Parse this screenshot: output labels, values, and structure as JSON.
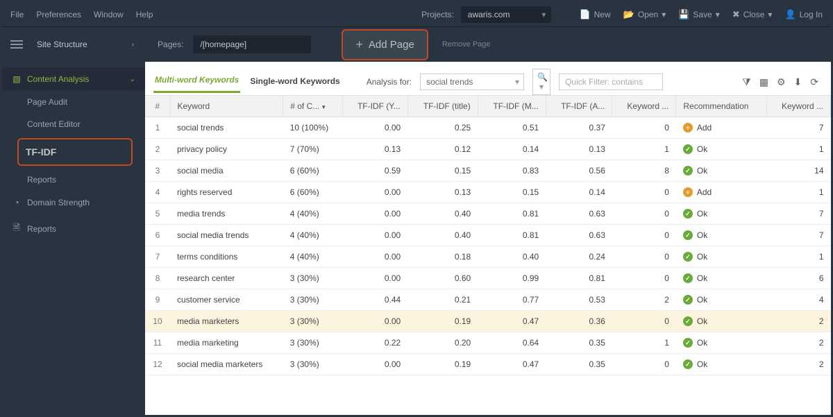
{
  "topmenu": {
    "file": "File",
    "preferences": "Preferences",
    "window": "Window",
    "help": "Help"
  },
  "projects": {
    "label": "Projects:",
    "value": "awaris.com"
  },
  "toolbar": {
    "new": "New",
    "open": "Open",
    "save": "Save",
    "close": "Close",
    "login": "Log In"
  },
  "secbar": {
    "structure_label": "Site Structure",
    "pages_label": "Pages:",
    "pages_value": "/[homepage]",
    "add_page": "Add Page",
    "remove_page": "Remove Page"
  },
  "sidebar": {
    "content_analysis": "Content Analysis",
    "page_audit": "Page Audit",
    "content_editor": "Content Editor",
    "tfidf": "TF-IDF",
    "reports": "Reports",
    "domain_strength": "Domain Strength",
    "global_reports": "Reports"
  },
  "tabs": {
    "multi": "Multi-word Keywords",
    "single": "Single-word Keywords",
    "analysis_for": "Analysis for:",
    "analysis_value": "social trends",
    "filter_placeholder": "Quick Filter: contains"
  },
  "columns": {
    "num": "#",
    "keyword": "Keyword",
    "count": "# of C...",
    "tfidf_y": "TF-IDF (Y...",
    "tfidf_title": "TF-IDF (title)",
    "tfidf_m": "TF-IDF (M...",
    "tfidf_a": "TF-IDF (A...",
    "kw": "Keyword ...",
    "rec": "Recommendation",
    "kw2": "Keyword ..."
  },
  "rec_labels": {
    "ok": "Ok",
    "add": "Add"
  },
  "rows": [
    {
      "n": 1,
      "keyword": "social trends",
      "count": "10 (100%)",
      "y": "0.00",
      "t": "0.25",
      "m": "0.51",
      "a": "0.37",
      "kw": "0",
      "rec": "add",
      "kw2": "7"
    },
    {
      "n": 2,
      "keyword": "privacy policy",
      "count": "7 (70%)",
      "y": "0.13",
      "t": "0.12",
      "m": "0.14",
      "a": "0.13",
      "kw": "1",
      "rec": "ok",
      "kw2": "1"
    },
    {
      "n": 3,
      "keyword": "social media",
      "count": "6 (60%)",
      "y": "0.59",
      "t": "0.15",
      "m": "0.83",
      "a": "0.56",
      "kw": "8",
      "rec": "ok",
      "kw2": "14"
    },
    {
      "n": 4,
      "keyword": "rights reserved",
      "count": "6 (60%)",
      "y": "0.00",
      "t": "0.13",
      "m": "0.15",
      "a": "0.14",
      "kw": "0",
      "rec": "add",
      "kw2": "1"
    },
    {
      "n": 5,
      "keyword": "media trends",
      "count": "4 (40%)",
      "y": "0.00",
      "t": "0.40",
      "m": "0.81",
      "a": "0.63",
      "kw": "0",
      "rec": "ok",
      "kw2": "7"
    },
    {
      "n": 6,
      "keyword": "social media trends",
      "count": "4 (40%)",
      "y": "0.00",
      "t": "0.40",
      "m": "0.81",
      "a": "0.63",
      "kw": "0",
      "rec": "ok",
      "kw2": "7"
    },
    {
      "n": 7,
      "keyword": "terms conditions",
      "count": "4 (40%)",
      "y": "0.00",
      "t": "0.18",
      "m": "0.40",
      "a": "0.24",
      "kw": "0",
      "rec": "ok",
      "kw2": "1"
    },
    {
      "n": 8,
      "keyword": "research center",
      "count": "3 (30%)",
      "y": "0.00",
      "t": "0.60",
      "m": "0.99",
      "a": "0.81",
      "kw": "0",
      "rec": "ok",
      "kw2": "6"
    },
    {
      "n": 9,
      "keyword": "customer service",
      "count": "3 (30%)",
      "y": "0.44",
      "t": "0.21",
      "m": "0.77",
      "a": "0.53",
      "kw": "2",
      "rec": "ok",
      "kw2": "4"
    },
    {
      "n": 10,
      "keyword": "media marketers",
      "count": "3 (30%)",
      "y": "0.00",
      "t": "0.19",
      "m": "0.47",
      "a": "0.36",
      "kw": "0",
      "rec": "ok",
      "kw2": "2",
      "highlight": true
    },
    {
      "n": 11,
      "keyword": "media marketing",
      "count": "3 (30%)",
      "y": "0.22",
      "t": "0.20",
      "m": "0.64",
      "a": "0.35",
      "kw": "1",
      "rec": "ok",
      "kw2": "2"
    },
    {
      "n": 12,
      "keyword": "social media marketers",
      "count": "3 (30%)",
      "y": "0.00",
      "t": "0.19",
      "m": "0.47",
      "a": "0.35",
      "kw": "0",
      "rec": "ok",
      "kw2": "2"
    }
  ]
}
